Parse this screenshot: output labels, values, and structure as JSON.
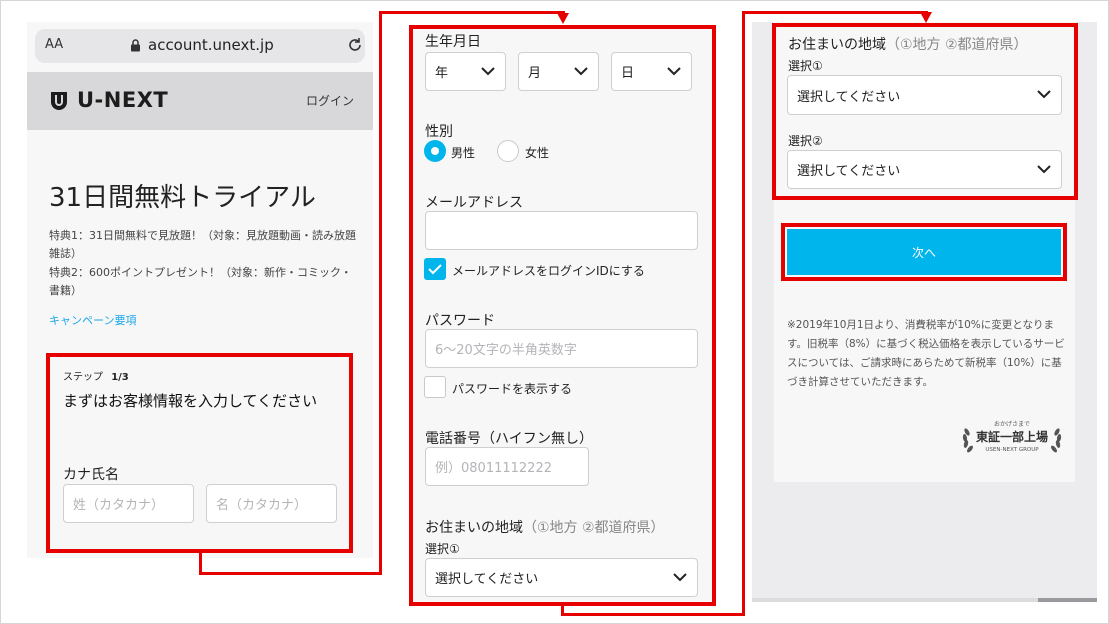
{
  "panel1": {
    "browser": {
      "text_size_label": "AA",
      "url": "account.unext.jp"
    },
    "header": {
      "logo_text": "U-NEXT",
      "login_label": "ログイン"
    },
    "trial_title": "31日間無料トライアル",
    "benefit1": "特典1：31日間無料で見放題！（対象：見放題動画・読み放題雑誌）",
    "benefit2": "特典2：600ポイントプレゼント！（対象：新作・コミック・書籍）",
    "campaign_link": "キャンペーン要項",
    "step_prefix": "ステップ",
    "step_value": "1/3",
    "heading": "まずはお客様情報を入力してください",
    "kana_label": "カナ氏名",
    "kana_sei_placeholder": "姓（カタカナ）",
    "kana_mei_placeholder": "名（カタカナ）"
  },
  "panel2": {
    "birthdate_label": "生年月日",
    "year_label": "年",
    "month_label": "月",
    "day_label": "日",
    "gender_label": "性別",
    "gender_options": [
      {
        "label": "男性",
        "selected": true
      },
      {
        "label": "女性",
        "selected": false
      }
    ],
    "email_label": "メールアドレス",
    "email_value": "",
    "email_as_login_label": "メールアドレスをログインIDにする",
    "email_as_login_checked": true,
    "password_label": "パスワード",
    "password_placeholder": "6〜20文字の半角英数字",
    "show_password_label": "パスワードを表示する",
    "show_password_checked": false,
    "phone_label": "電話番号（ハイフン無し）",
    "phone_placeholder": "例）08011112222",
    "region_label": "お住まいの地域",
    "region_hint": "（①地方 ②都道府県）",
    "select1_label": "選択①",
    "select_placeholder": "選択してください"
  },
  "panel3": {
    "region_label": "お住まいの地域",
    "region_hint": "（①地方 ②都道府県）",
    "select1_label": "選択①",
    "select2_label": "選択②",
    "select_placeholder": "選択してください",
    "next_button": "次へ",
    "tax_note": "※2019年10月1日より、消費税率が10%に変更となります。旧税率（8%）に基づく税込価格を表示しているサービスについては、ご請求時にあらためて新税率（10%）に基づき計算させていただきます。",
    "badge": {
      "top": "おかげさまで",
      "main": "東証一部上場",
      "bottom": "USEN-NEXT GROUP"
    }
  },
  "colors": {
    "accent": "#00b4ec",
    "highlight_red": "#e60000",
    "link": "#1aa7e8"
  }
}
